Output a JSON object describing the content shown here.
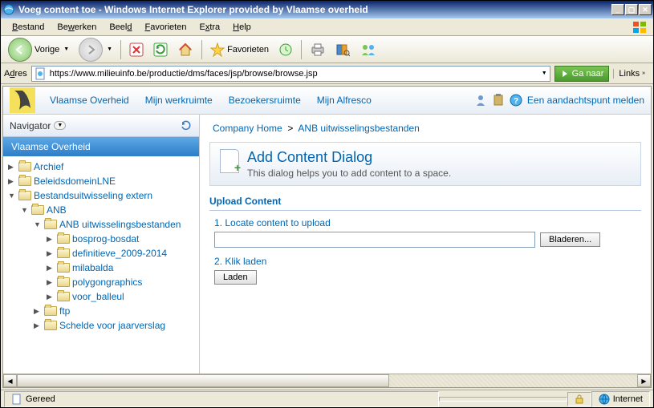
{
  "window": {
    "title": "Voeg content toe - Windows Internet Explorer provided by Vlaamse overheid"
  },
  "menubar": {
    "items": [
      "Bestand",
      "Bewerken",
      "Beeld",
      "Favorieten",
      "Extra",
      "Help"
    ]
  },
  "toolbar": {
    "back": "Vorige",
    "favorites": "Favorieten"
  },
  "address": {
    "label": "Adres",
    "url": "https://www.milieuinfo.be/productie/dms/faces/jsp/browse/browse.jsp",
    "go": "Ga naar",
    "links": "Links"
  },
  "appnav": {
    "items": [
      "Vlaamse Overheid",
      "Mijn werkruimte",
      "Bezoekersruimte",
      "Mijn Alfresco"
    ],
    "helplink": "Een aandachtspunt melden"
  },
  "sidebar": {
    "header": "Navigator",
    "root": "Vlaamse Overheid",
    "nodes": [
      {
        "label": "Archief",
        "expanded": false,
        "depth": 0
      },
      {
        "label": "BeleidsdomeinLNE",
        "expanded": false,
        "depth": 0
      },
      {
        "label": "Bestandsuitwisseling extern",
        "expanded": true,
        "depth": 0
      },
      {
        "label": "ANB",
        "expanded": true,
        "depth": 1
      },
      {
        "label": "ANB uitwisselingsbestanden",
        "expanded": true,
        "depth": 2
      },
      {
        "label": "bosprog-bosdat",
        "expanded": false,
        "depth": 3
      },
      {
        "label": "definitieve_2009-2014",
        "expanded": false,
        "depth": 3
      },
      {
        "label": "milabalda",
        "expanded": false,
        "depth": 3
      },
      {
        "label": "polygongraphics",
        "expanded": false,
        "depth": 3
      },
      {
        "label": "voor_balleul",
        "expanded": false,
        "depth": 3
      },
      {
        "label": "ftp",
        "expanded": false,
        "depth": 2
      },
      {
        "label": "Schelde voor jaarverslag",
        "expanded": false,
        "depth": 2
      }
    ]
  },
  "breadcrumb": {
    "items": [
      "Company Home",
      "ANB uitwisselingsbestanden"
    ],
    "sep": ">"
  },
  "dialog": {
    "title": "Add Content Dialog",
    "subtitle": "This dialog helps you to add content to a space.",
    "section": "Upload Content",
    "step1": "1. Locate content to upload",
    "browse": "Bladeren...",
    "step2": "2. Klik laden",
    "load": "Laden",
    "filepath": ""
  },
  "status": {
    "ready": "Gereed",
    "zone": "Internet"
  }
}
